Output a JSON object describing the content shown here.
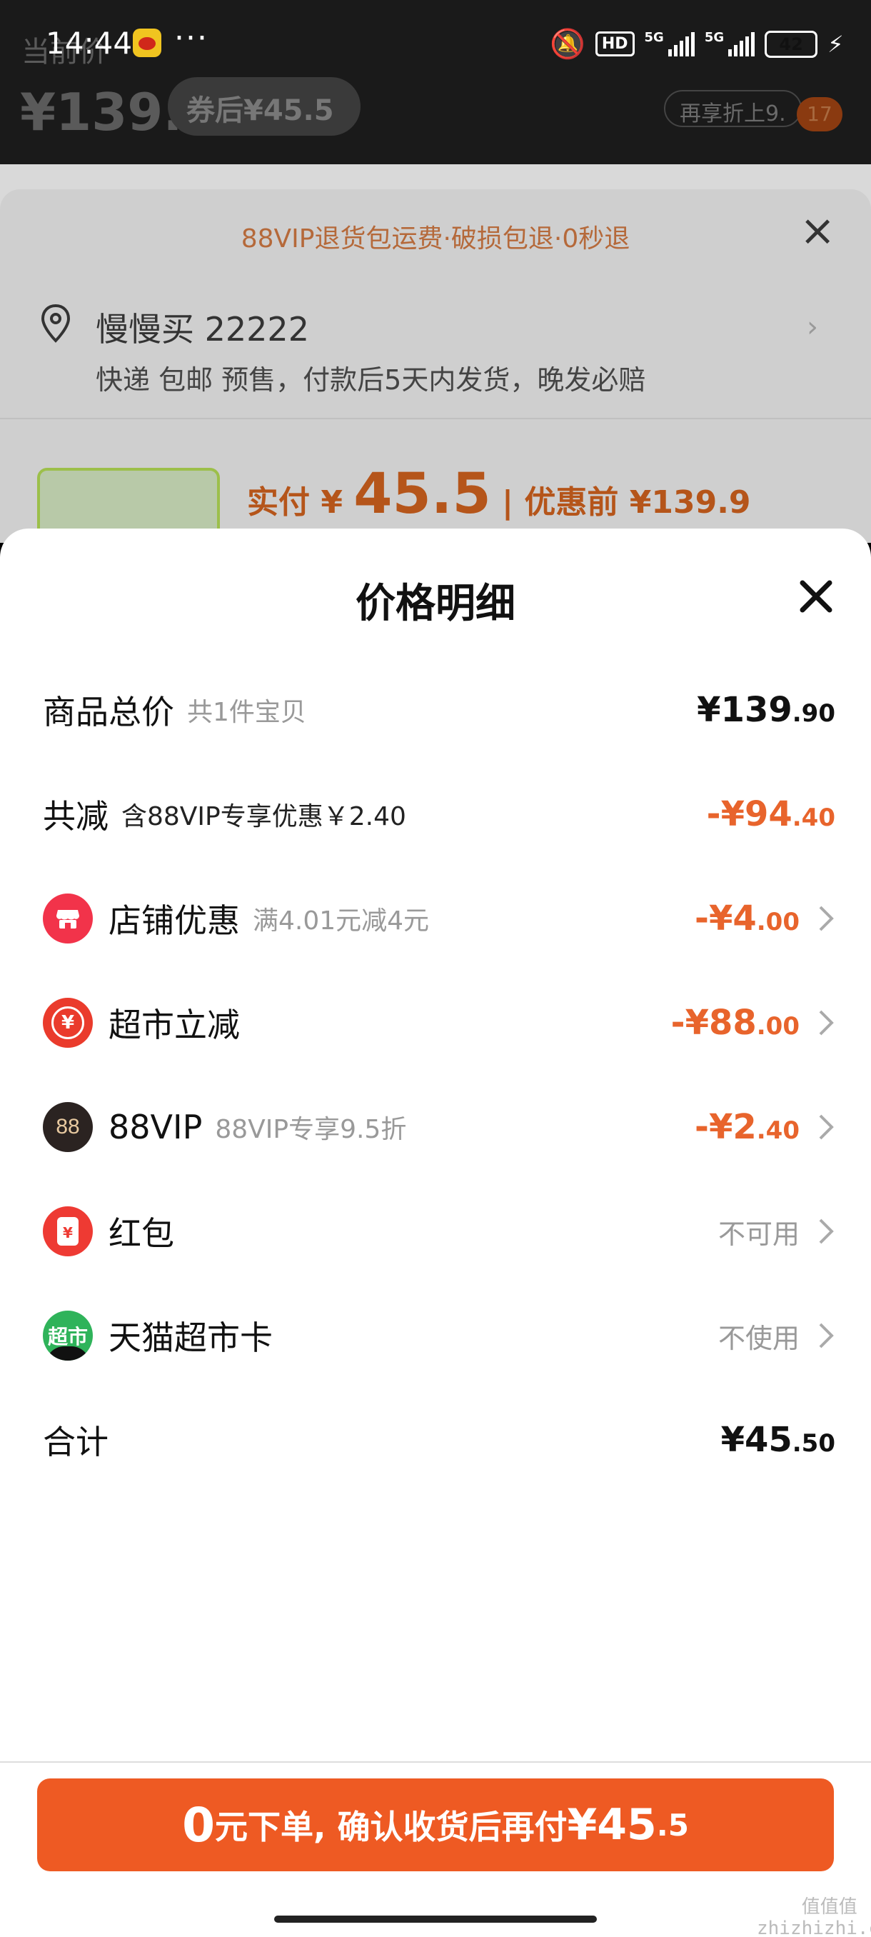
{
  "status_bar": {
    "time": "14:44",
    "dots": "···",
    "hd": "HD",
    "network": "5G",
    "battery": "42"
  },
  "background": {
    "price_label": "当前价",
    "price": "¥139.9",
    "coupon_price": "券后¥45.5",
    "more_discount": "再享折上9.",
    "cart_count": "17",
    "banner": "88VIP退货包运费·破损包退·0秒退",
    "address_name": "慢慢买 22222",
    "address_detail": "快递 包邮 预售，付款后5天内发货，晚发必赔",
    "paid_label": "实付 ¥",
    "paid_amount": "45.5",
    "before_discount": "| 优惠前 ¥139.9"
  },
  "modal": {
    "title": "价格明细",
    "rows": [
      {
        "label": "商品总价",
        "sub": "共1件宝贝",
        "amount_int": "¥139",
        "amount_dec": ".90"
      },
      {
        "label": "共减",
        "sub": "含88VIP专享优惠￥2.40",
        "amount_int": "-¥94",
        "amount_dec": ".40"
      },
      {
        "label": "店铺优惠",
        "sub": "满4.01元减4元",
        "amount_int": "-¥4",
        "amount_dec": ".00",
        "icon": "shop-icon"
      },
      {
        "label": "超市立减",
        "sub": "",
        "amount_int": "-¥88",
        "amount_dec": ".00",
        "icon": "yen-coin-icon"
      },
      {
        "label": "88VIP",
        "sub": "88VIP专享9.5折",
        "amount_int": "-¥2",
        "amount_dec": ".40",
        "icon": "vip88-icon",
        "icon_text": "88"
      },
      {
        "label": "红包",
        "sub": "",
        "status": "不可用",
        "icon": "red-envelope-icon"
      },
      {
        "label": "天猫超市卡",
        "sub": "",
        "status": "不使用",
        "icon": "tmall-market-card-icon",
        "icon_text": "超市"
      },
      {
        "label": "合计",
        "sub": "",
        "amount_int": "¥45",
        "amount_dec": ".50"
      }
    ]
  },
  "pay_button": {
    "zero": "0",
    "text1": " 元下单, 确认收货后再付 ",
    "amount_int": "¥45",
    "amount_dec": ".5"
  },
  "watermark": "值值值\nzhizhizhi.com",
  "colors": {
    "accent": "#ee5a23",
    "discount_text": "#e8642c",
    "shop_icon": "#f2334a",
    "vip_icon": "#2b2321",
    "card_icon": "#2fb35a"
  }
}
